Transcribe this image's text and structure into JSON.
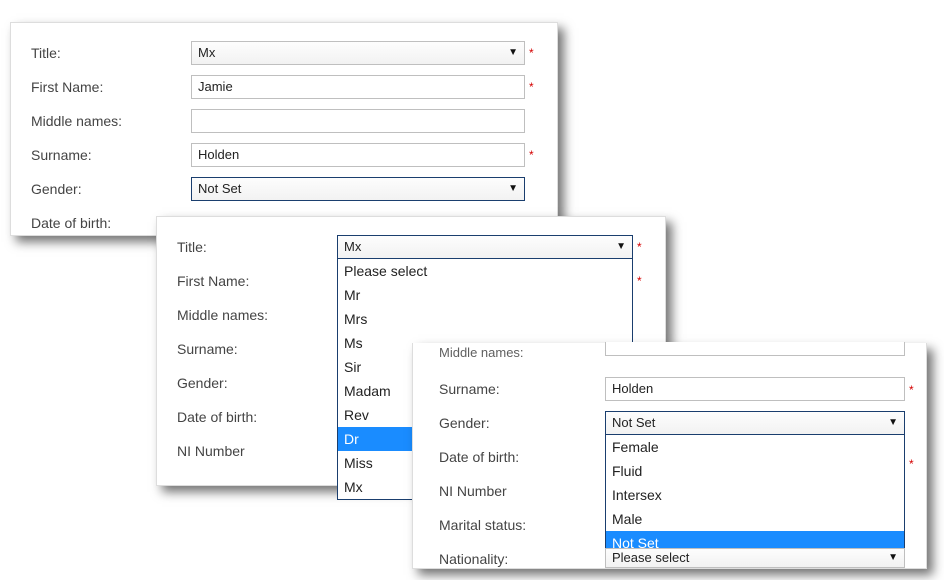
{
  "card1": {
    "labels": {
      "title": "Title:",
      "firstName": "First Name:",
      "middleNames": "Middle names:",
      "surname": "Surname:",
      "gender": "Gender:",
      "dob": "Date of birth:"
    },
    "values": {
      "title": "Mx",
      "firstName": "Jamie",
      "middleNames": "",
      "surname": "Holden",
      "gender": "Not Set"
    },
    "required": "*"
  },
  "card2": {
    "labels": {
      "title": "Title:",
      "firstName": "First Name:",
      "middleNames": "Middle names:",
      "surname": "Surname:",
      "gender": "Gender:",
      "dob": "Date of birth:",
      "ni": "NI Number"
    },
    "values": {
      "title": "Mx"
    },
    "titleOptions": [
      "Please select",
      "Mr",
      "Mrs",
      "Ms",
      "Sir",
      "Madam",
      "Rev",
      "Dr",
      "Miss",
      "Mx"
    ],
    "highlightIndex": 7,
    "required": "*"
  },
  "card3": {
    "labels": {
      "middleNamesCut": "Middle names:",
      "surname": "Surname:",
      "gender": "Gender:",
      "dob": "Date of birth:",
      "ni": "NI Number",
      "marital": "Marital status:",
      "nationality": "Nationality:"
    },
    "values": {
      "surname": "Holden",
      "gender": "Not Set",
      "nationality": "Please select"
    },
    "genderOptions": [
      "Female",
      "Fluid",
      "Intersex",
      "Male",
      "Not Set"
    ],
    "highlightIndex": 4,
    "required": "*"
  }
}
